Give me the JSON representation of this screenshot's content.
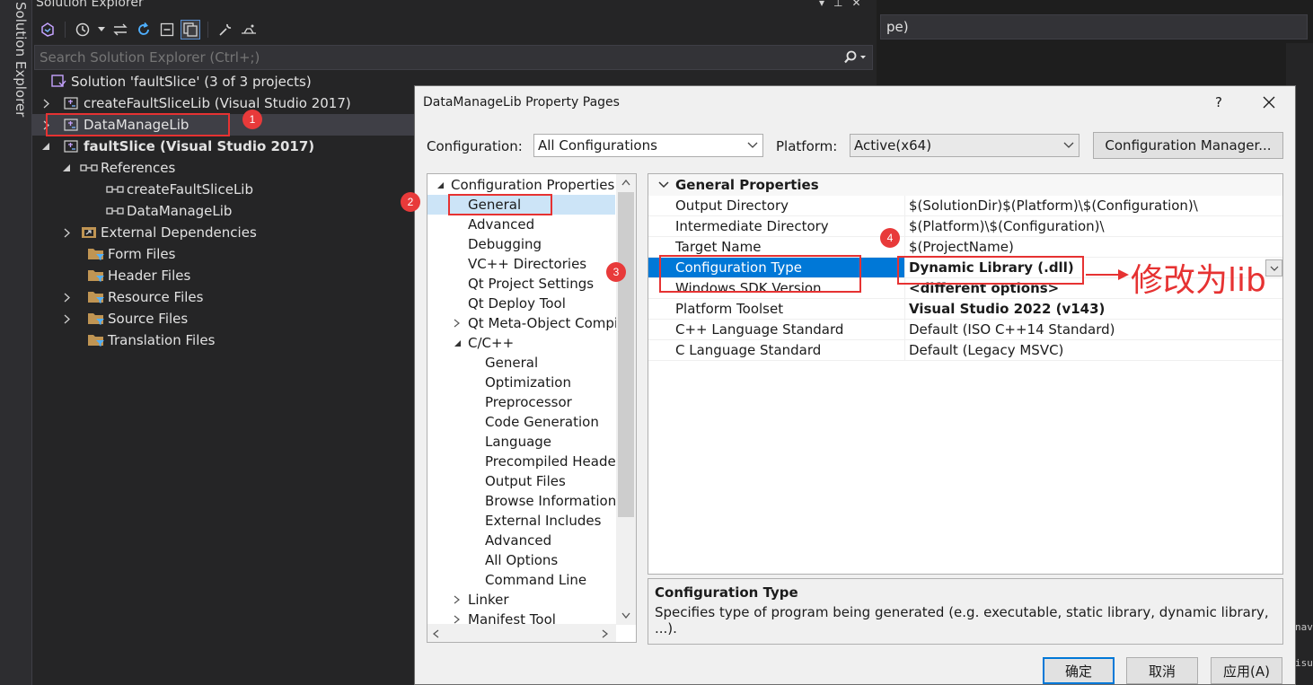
{
  "vertical_tab": {
    "label": "Solution Explorer"
  },
  "solution_explorer": {
    "title": "Solution Explorer",
    "search": {
      "placeholder": "Search Solution Explorer (Ctrl+;)"
    },
    "tree": [
      {
        "label": "Solution 'faultSlice' (3 of 3 projects)",
        "icon": "solution-icon"
      },
      {
        "label": "createFaultSliceLib (Visual Studio 2017)",
        "icon": "project-icon"
      },
      {
        "label": "DataManageLib",
        "icon": "project-icon"
      },
      {
        "label": "faultSlice (Visual Studio 2017)",
        "icon": "project-icon"
      },
      {
        "label": "References",
        "icon": "references-icon"
      },
      {
        "label": "createFaultSliceLib",
        "icon": "reference-icon"
      },
      {
        "label": "DataManageLib",
        "icon": "reference-icon"
      },
      {
        "label": "External Dependencies",
        "icon": "external-deps-icon"
      },
      {
        "label": "Form Files",
        "icon": "filter-folder-icon"
      },
      {
        "label": "Header Files",
        "icon": "filter-folder-icon"
      },
      {
        "label": "Resource Files",
        "icon": "filter-folder-icon"
      },
      {
        "label": "Source Files",
        "icon": "filter-folder-icon"
      },
      {
        "label": "Translation Files",
        "icon": "filter-folder-icon"
      }
    ]
  },
  "background_editor": {
    "combo_text": "pe)",
    "side_text_1": "nav",
    "side_text_2": "isu"
  },
  "dialog": {
    "title": "DataManageLib Property Pages",
    "help": "?",
    "configuration_label": "Configuration:",
    "configuration_value": "All Configurations",
    "platform_label": "Platform:",
    "platform_value": "Active(x64)",
    "config_manager_button": "Configuration Manager...",
    "nav_tree": [
      "Configuration Properties",
      "General",
      "Advanced",
      "Debugging",
      "VC++ Directories",
      "Qt Project Settings",
      "Qt Deploy Tool",
      "Qt Meta-Object Compi",
      "C/C++",
      "General",
      "Optimization",
      "Preprocessor",
      "Code Generation",
      "Language",
      "Precompiled Heade",
      "Output Files",
      "Browse Information",
      "External Includes",
      "Advanced",
      "All Options",
      "Command Line",
      "Linker",
      "Manifest Tool"
    ],
    "grid": {
      "section": "General Properties",
      "rows": [
        {
          "key": "Output Directory",
          "value": "$(SolutionDir)$(Platform)\\$(Configuration)\\"
        },
        {
          "key": "Intermediate Directory",
          "value": "$(Platform)\\$(Configuration)\\"
        },
        {
          "key": "Target Name",
          "value": "$(ProjectName)"
        },
        {
          "key": "Configuration Type",
          "value": "Dynamic Library (.dll)"
        },
        {
          "key": "Windows SDK Version",
          "value": "<different options>"
        },
        {
          "key": "Platform Toolset",
          "value": "Visual Studio 2022 (v143)"
        },
        {
          "key": "C++ Language Standard",
          "value": "Default (ISO C++14 Standard)"
        },
        {
          "key": "C Language Standard",
          "value": "Default (Legacy MSVC)"
        }
      ]
    },
    "description": {
      "title": "Configuration Type",
      "text": "Specifies type of program being generated (e.g. executable, static library, dynamic library, ...)."
    },
    "buttons": {
      "ok": "确定",
      "cancel": "取消",
      "apply": "应用(A)"
    }
  },
  "annotations": {
    "steps": [
      "1",
      "2",
      "3",
      "4"
    ],
    "note": "修改为lib",
    "color": "#e63232"
  },
  "colors": {
    "accent": "#0078d7",
    "ide_bg": "#1e1e1e",
    "panel_bg": "#252526"
  }
}
